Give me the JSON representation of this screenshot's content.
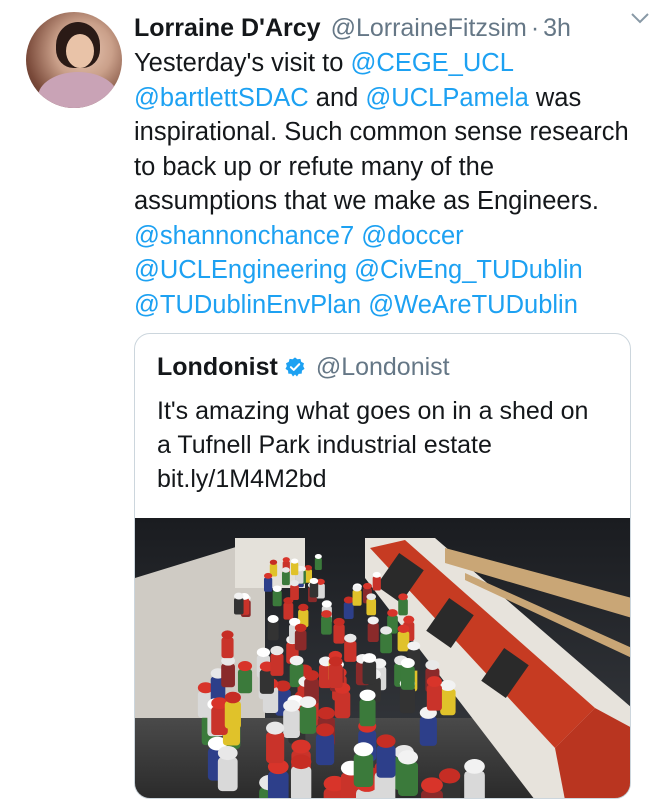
{
  "tweet": {
    "author_name": "Lorraine D'Arcy",
    "author_handle": "@LorraineFitzsim",
    "separator": "·",
    "time": "3h",
    "text_segments": [
      {
        "text": "Yesterday's visit to ",
        "mention": false
      },
      {
        "text": "@CEGE_UCL",
        "mention": true
      },
      {
        "text": " ",
        "mention": false
      },
      {
        "text": "@bartlettSDAC",
        "mention": true
      },
      {
        "text": " and ",
        "mention": false
      },
      {
        "text": "@UCLPamela",
        "mention": true
      },
      {
        "text": " was inspirational. Such common sense research to back up or refute many of the assumptions that we make as Engineers. ",
        "mention": false
      },
      {
        "text": "@shannonchance7",
        "mention": true
      },
      {
        "text": "  ",
        "mention": false
      },
      {
        "text": "@doccer",
        "mention": true
      },
      {
        "text": " ",
        "mention": false
      },
      {
        "text": "@UCLEngineering",
        "mention": true
      },
      {
        "text": " ",
        "mention": false
      },
      {
        "text": "@CivEng_TUDublin",
        "mention": true
      },
      {
        "text": " ",
        "mention": false
      },
      {
        "text": "@TUDublinEnvPlan",
        "mention": true
      },
      {
        "text": " ",
        "mention": false
      },
      {
        "text": "@WeAreTUDublin",
        "mention": true
      }
    ]
  },
  "quoted": {
    "author_name": "Londonist",
    "author_handle": "@Londonist",
    "text": "It's amazing what goes on in a shed on a Tufnell Park industrial estate bit.ly/1M4M2bd"
  },
  "icons": {
    "menu": "chevron-down-icon",
    "verified": "verified-badge-icon"
  },
  "colors": {
    "mention": "#1da1f2",
    "secondary_text": "#657786",
    "verified": "#1da1f2"
  }
}
